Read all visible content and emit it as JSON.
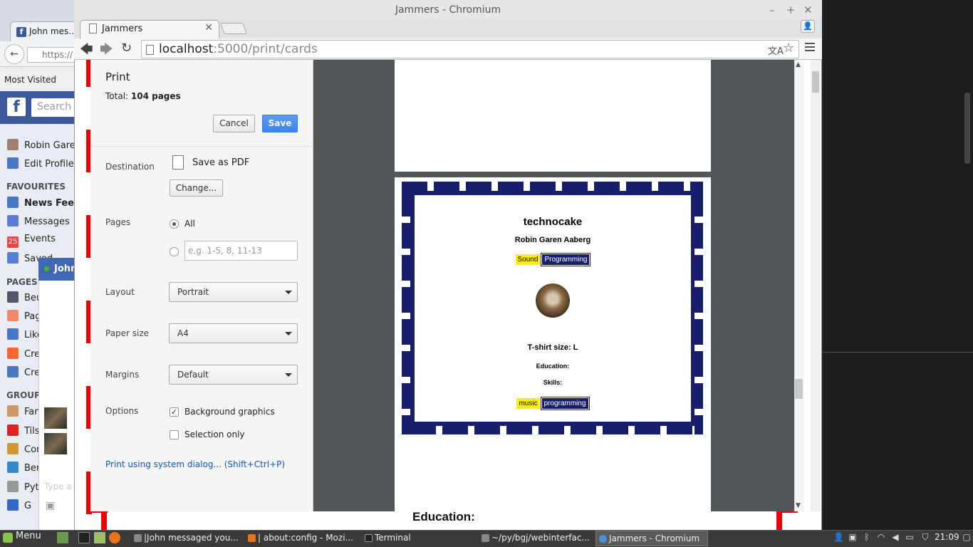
{
  "background_window": {
    "tab_title": "John mes…",
    "url_text": "https://",
    "bookmarks_label": "Most Visited",
    "search_placeholder": "Search",
    "profile_items": [
      {
        "label": "Robin Garen"
      },
      {
        "label": "Edit Profile"
      }
    ],
    "favourites_header": "FAVOURITES",
    "favourites": [
      {
        "label": "News Feed"
      },
      {
        "label": "Messages"
      },
      {
        "label": "Events"
      },
      {
        "label": "Saved"
      }
    ],
    "pages_header": "PAGES",
    "pages": [
      {
        "label": "Beu"
      },
      {
        "label": "Pag"
      },
      {
        "label": "Like"
      },
      {
        "label": "Cre"
      },
      {
        "label": "Cre"
      }
    ],
    "groups_header": "GROUP",
    "groups": [
      {
        "label": "Fan"
      },
      {
        "label": "Tils"
      },
      {
        "label": "Con"
      },
      {
        "label": "Ben"
      },
      {
        "label": "Pyt"
      },
      {
        "label": "G"
      }
    ],
    "chat_name": "John",
    "chat_input_placeholder": "Type a",
    "events_icon_number": "25"
  },
  "window": {
    "title": "Jammers - Chromium",
    "tab_label": "Jammers",
    "url_host": "localhost",
    "url_path": ":5000/print/cards"
  },
  "print": {
    "title": "Print",
    "total_label": "Total: ",
    "total_value": "104 pages",
    "cancel_label": "Cancel",
    "save_label": "Save",
    "destination_label": "Destination",
    "destination_value": "Save as PDF",
    "change_label": "Change...",
    "pages_label": "Pages",
    "pages_all_label": "All",
    "pages_range_placeholder": "e.g. 1-5, 8, 11-13",
    "layout_label": "Layout",
    "layout_value": "Portrait",
    "paper_label": "Paper size",
    "paper_value": "A4",
    "margins_label": "Margins",
    "margins_value": "Default",
    "options_label": "Options",
    "option_bg_label": "Background graphics",
    "option_bg_checked": true,
    "option_sel_label": "Selection only",
    "option_sel_checked": false,
    "system_dialog_link": "Print using system dialog... (Shift+Ctrl+P)"
  },
  "card": {
    "name": "technocake",
    "full_name": "Robin Garen Aaberg",
    "tags": [
      "Sound",
      "Programming"
    ],
    "tshirt": "T-shirt size: L",
    "education_label": "Education:",
    "skills_label": "Skills:",
    "skills": [
      "music",
      "programming"
    ]
  },
  "page_behind_text": "Education:",
  "taskbar": {
    "menu_label": "Menu",
    "tasks": [
      {
        "label": "|John messaged you..."
      },
      {
        "label": "| about:config - Mozi..."
      },
      {
        "label": "Terminal"
      },
      {
        "label": "~/py/bgj/webinterfac..."
      },
      {
        "label": "Jammers - Chromium"
      }
    ],
    "clock": "21:09"
  },
  "colors": {
    "card_navy": "#181d6e",
    "tag_yellow": "#ffef00",
    "save_blue": "#3f84f2",
    "facebook_blue": "#3b5998"
  }
}
